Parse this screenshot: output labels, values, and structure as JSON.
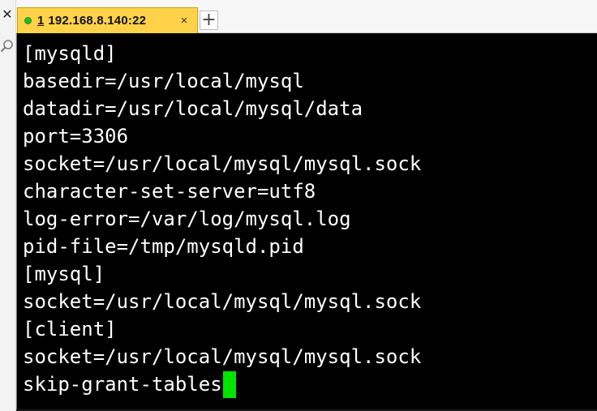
{
  "tab": {
    "number": "1",
    "title": "192.168.8.140:22",
    "close_glyph": "×",
    "status_color": "#23b923",
    "accent_color": "#ffd24a"
  },
  "new_tab_glyph": "+",
  "left_strip": {
    "close_glyph": "✕",
    "search_icon": "search-icon"
  },
  "terminal": {
    "background": "#000000",
    "foreground": "#ffffff",
    "cursor_color": "#00e400",
    "lines": [
      "[mysqld]",
      "basedir=/usr/local/mysql",
      "datadir=/usr/local/mysql/data",
      "port=3306",
      "socket=/usr/local/mysql/mysql.sock",
      "character-set-server=utf8",
      "log-error=/var/log/mysql.log",
      "pid-file=/tmp/mysqld.pid",
      "[mysql]",
      "socket=/usr/local/mysql/mysql.sock",
      "[client]",
      "socket=/usr/local/mysql/mysql.sock",
      "skip-grant-tables"
    ]
  }
}
